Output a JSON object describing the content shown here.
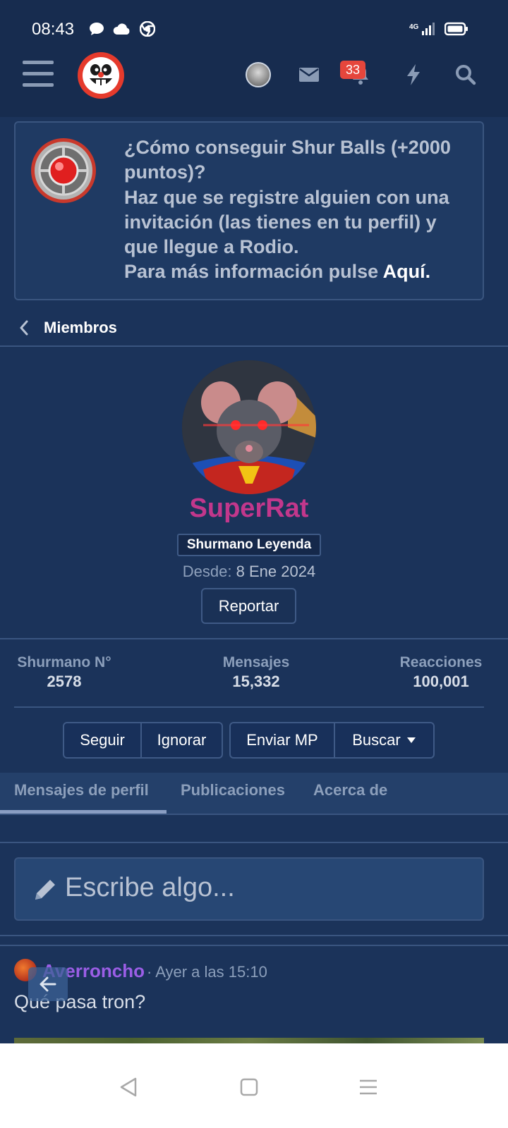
{
  "status_bar": {
    "time": "08:43",
    "network": "4G",
    "icons": [
      "chat-bubble-icon",
      "cloud-icon",
      "chrome-icon",
      "signal-icon",
      "battery-icon"
    ]
  },
  "nav": {
    "icons": [
      "hamburger-menu-icon",
      "site-logo",
      "user-avatar",
      "envelope-icon",
      "bell-icon",
      "bolt-icon",
      "search-icon"
    ],
    "alerts_badge": "33"
  },
  "notice": {
    "line1": "¿Cómo conseguir Shur Balls (+2000",
    "line2": "puntos)?",
    "line3": "Haz que se registre alguien con una",
    "line4": "invitación (las tienes en tu perfil) y",
    "line5": "que llegue a Rodio.",
    "line6_prefix": "Para más información pulse ",
    "link": "Aquí."
  },
  "breadcrumb": {
    "label": "Miembros"
  },
  "profile": {
    "username": "SuperRat",
    "title": "Shurmano Leyenda",
    "since_label": "Desde:",
    "since_value": "8 Ene 2024",
    "report": "Reportar"
  },
  "stats": [
    {
      "label": "Shurmano N°",
      "value": "2578"
    },
    {
      "label": "Mensajes",
      "value": "15,332"
    },
    {
      "label": "Reacciones",
      "value": "100,001"
    }
  ],
  "actions": {
    "follow": "Seguir",
    "ignore": "Ignorar",
    "send_pm": "Enviar MP",
    "search": "Buscar"
  },
  "tabs": [
    "Mensajes de perfil",
    "Publicaciones",
    "Acerca de"
  ],
  "composer": {
    "placeholder": "Escribe algo..."
  },
  "post": {
    "author": "Averroncho",
    "meta": "· Ayer a las 15:10",
    "body": "Qué pasa tron?"
  },
  "colors": {
    "background": "#1b335a",
    "username": "#c2378c",
    "post_author": "#9b5ee6",
    "badge": "#e5463c"
  }
}
